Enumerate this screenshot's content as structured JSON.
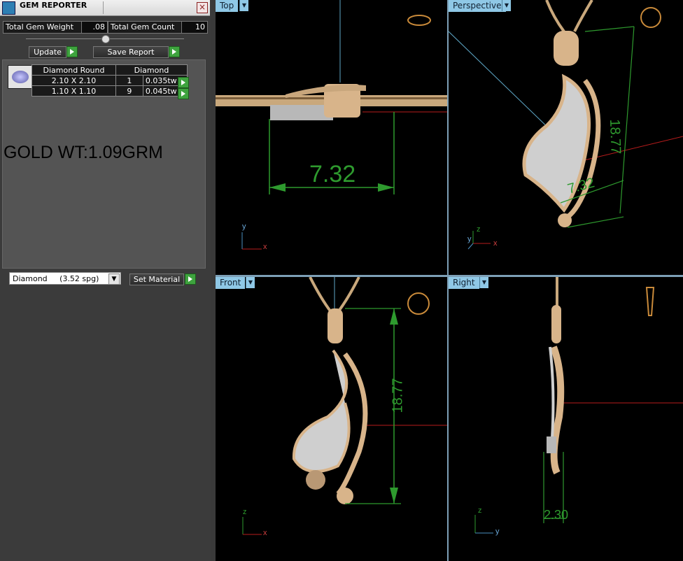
{
  "window": {
    "title": "GEM REPORTER",
    "close_symbol": "×"
  },
  "summary": {
    "total_weight_label": "Total Gem Weight",
    "total_weight_value": ".08",
    "total_count_label": "Total Gem Count",
    "total_count_value": "10"
  },
  "actions": {
    "update_label": "Update",
    "save_report_label": "Save Report"
  },
  "gem_table": {
    "headers": [
      "Diamond Round",
      "Diamond"
    ],
    "rows": [
      {
        "size": "2.10 X 2.10",
        "count": "1",
        "weight": "0.035tw"
      },
      {
        "size": "1.10 X 1.10",
        "count": "9",
        "weight": "0.045tw"
      }
    ]
  },
  "note": "GOLD WT:1.09GRM",
  "material": {
    "selected": "Diamond     (3.52 spg)",
    "set_label": "Set Material"
  },
  "viewports": {
    "top": {
      "label": "Top",
      "dimension": "7.32",
      "axes": [
        "y",
        "x"
      ]
    },
    "perspective": {
      "label": "Perspective",
      "dimension_a": "18.77",
      "dimension_b": "7.32",
      "axes": [
        "z",
        "y",
        "x"
      ]
    },
    "front": {
      "label": "Front",
      "dimension": "18.77",
      "axes": [
        "z",
        "x"
      ]
    },
    "right": {
      "label": "Right",
      "dimension": "2.30",
      "axes": [
        "z",
        "y"
      ]
    }
  },
  "colors": {
    "dimension": "#2e9a2e",
    "gold": "#d8b48a",
    "tab": "#8fc8e6"
  }
}
